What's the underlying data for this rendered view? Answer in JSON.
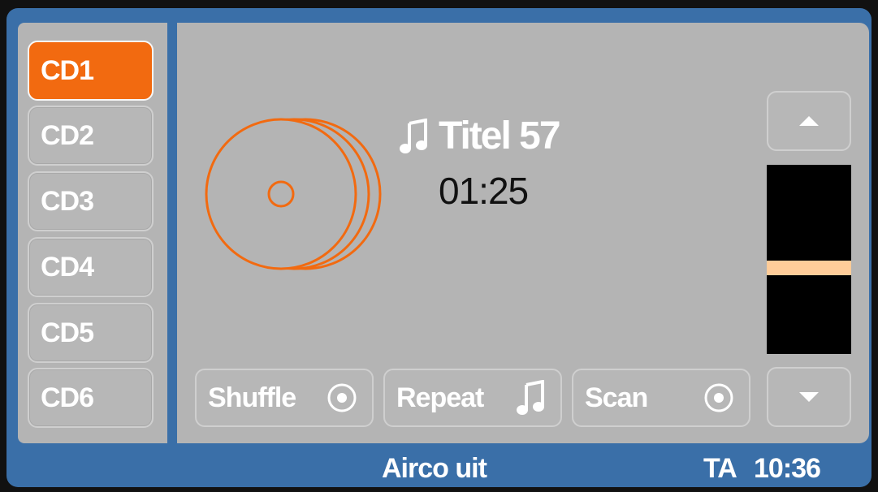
{
  "cd_changer": {
    "items": [
      {
        "label": "CD1",
        "active": true
      },
      {
        "label": "CD2",
        "active": false
      },
      {
        "label": "CD3",
        "active": false
      },
      {
        "label": "CD4",
        "active": false
      },
      {
        "label": "CD5",
        "active": false
      },
      {
        "label": "CD6",
        "active": false
      }
    ]
  },
  "now_playing": {
    "track_title": "Titel 57",
    "elapsed_time": "01:25",
    "icon": "music-note-icon"
  },
  "controls": {
    "shuffle": {
      "label": "Shuffle",
      "icon": "radio-dot-icon"
    },
    "repeat": {
      "label": "Repeat",
      "icon": "music-note-icon"
    },
    "scan": {
      "label": "Scan",
      "icon": "radio-dot-icon"
    }
  },
  "scroll": {
    "up_icon": "triangle-up-icon",
    "down_icon": "triangle-down-icon",
    "level_fraction": 0.55
  },
  "status_bar": {
    "climate": "Airco uit",
    "traffic_announcement": "TA",
    "clock": "10:36"
  },
  "colors": {
    "accent": "#f26a10",
    "frame": "#3a6fa8",
    "panel": "#b4b4b4",
    "level_marker": "#ffcc99"
  }
}
